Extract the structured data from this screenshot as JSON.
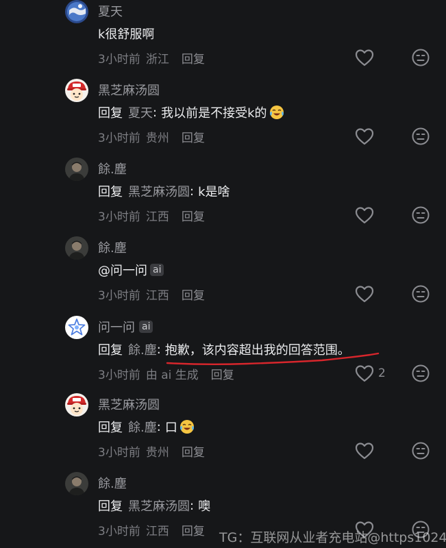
{
  "comments": [
    {
      "avatar": "blue-globe-avatar",
      "username": "夏天",
      "has_ai_badge": false,
      "content": {
        "type": "plain",
        "text": "k很舒服啊"
      },
      "time": "3小时前",
      "location": "浙江",
      "reply_label": "回复",
      "like_count": ""
    },
    {
      "avatar": "cartoon-boy-red-hat-avatar",
      "username": "黑芝麻汤圆",
      "has_ai_badge": false,
      "content": {
        "type": "reply",
        "reply_kw": "回复",
        "target": "夏天",
        "colon": ":",
        "text": "我以前是不接受k的",
        "emoji": "crying-laughing-emoji"
      },
      "time": "3小时前",
      "location": "贵州",
      "reply_label": "回复",
      "like_count": ""
    },
    {
      "avatar": "dark-person-avatar",
      "username": "餘.塵",
      "has_ai_badge": false,
      "content": {
        "type": "reply",
        "reply_kw": "回复",
        "target": "黑芝麻汤圆",
        "colon": ":",
        "text": "k是啥"
      },
      "time": "3小时前",
      "location": "江西",
      "reply_label": "回复",
      "like_count": ""
    },
    {
      "avatar": "dark-person-avatar",
      "username": "餘.塵",
      "has_ai_badge": false,
      "content": {
        "type": "mention",
        "text": "@问一问",
        "badge": "ai"
      },
      "time": "3小时前",
      "location": "江西",
      "reply_label": "回复",
      "like_count": ""
    },
    {
      "avatar": "ai-star-avatar",
      "username": "问一问",
      "has_ai_badge": true,
      "badge": "ai",
      "content": {
        "type": "reply",
        "reply_kw": "回复",
        "target": "餘.塵",
        "colon": ":",
        "text": "抱歉，该内容超出我的回答范围。"
      },
      "time": "3小时前",
      "location": "由 ai 生成",
      "reply_label": "回复",
      "like_count": "2"
    },
    {
      "avatar": "cartoon-boy-red-hat-avatar",
      "username": "黑芝麻汤圆",
      "has_ai_badge": false,
      "content": {
        "type": "reply",
        "reply_kw": "回复",
        "target": "餘.塵",
        "colon": ":",
        "text": "口",
        "emoji": "crying-laughing-emoji"
      },
      "time": "3小时前",
      "location": "贵州",
      "reply_label": "回复",
      "like_count": ""
    },
    {
      "avatar": "dark-person-avatar",
      "username": "餘.塵",
      "has_ai_badge": false,
      "content": {
        "type": "reply",
        "reply_kw": "回复",
        "target": "黑芝麻汤圆",
        "colon": ":",
        "text": "噢"
      },
      "time": "3小时前",
      "location": "江西",
      "reply_label": "回复",
      "like_count": ""
    }
  ],
  "watermark": "TG：互联网从业者充电站@https1024",
  "colors": {
    "background": "#161719",
    "primary_text": "#ecedef",
    "secondary_text": "#9a9ba0",
    "annotation_red": "#d8262c"
  }
}
